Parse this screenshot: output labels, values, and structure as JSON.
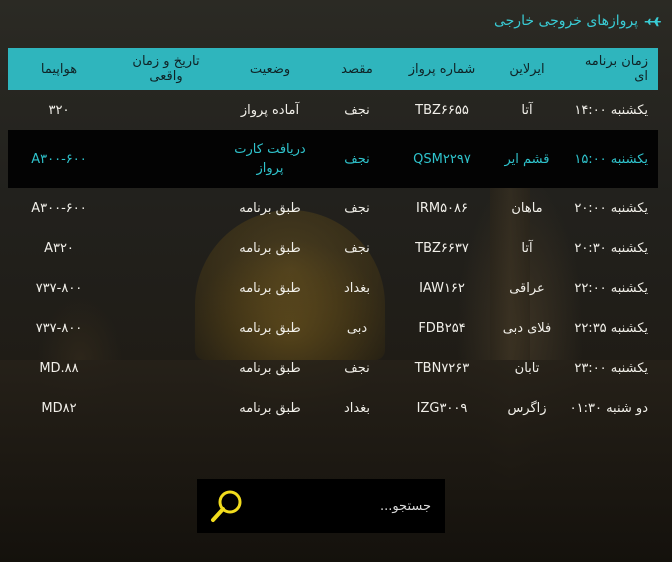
{
  "header": {
    "title": "پروازهای خروجی خارجی",
    "icon": "airplane-icon"
  },
  "table": {
    "columns": [
      "زمان برنامه ای",
      "ایرلاین",
      "شماره پرواز",
      "مقصد",
      "وضعیت",
      "تاریخ و زمان واقعی",
      "هواپیما"
    ],
    "rows": [
      {
        "time": "یکشنبه ۱۴:۰۰",
        "airline": "آتا",
        "flight": "TBZ۶۶۵۵",
        "dest": "نجف",
        "status": "آماده پرواز",
        "actual": "",
        "aircraft": "۳۲۰"
      },
      {
        "time": "یکشنبه ۱۵:۰۰",
        "airline": "قشم ایر",
        "flight": "QSM۲۲۹۷",
        "dest": "نجف",
        "status": "دریافت کارت پرواز",
        "actual": "",
        "aircraft": "A۳۰۰-۶۰۰"
      },
      {
        "time": "یکشنبه ۲۰:۰۰",
        "airline": "ماهان",
        "flight": "IRM۵۰۸۶",
        "dest": "نجف",
        "status": "طبق برنامه",
        "actual": "",
        "aircraft": "A۳۰۰-۶۰۰"
      },
      {
        "time": "یکشنبه ۲۰:۳۰",
        "airline": "آتا",
        "flight": "TBZ۶۶۳۷",
        "dest": "نجف",
        "status": "طبق برنامه",
        "actual": "",
        "aircraft": "A۳۲۰"
      },
      {
        "time": "یکشنبه ۲۲:۰۰",
        "airline": "عراقی",
        "flight": "IAW۱۶۲",
        "dest": "بغداد",
        "status": "طبق برنامه",
        "actual": "",
        "aircraft": "۷۳۷-۸۰۰"
      },
      {
        "time": "یکشنبه ۲۲:۳۵",
        "airline": "فلای دبی",
        "flight": "FDB۲۵۴",
        "dest": "دبی",
        "status": "طبق برنامه",
        "actual": "",
        "aircraft": "۷۳۷-۸۰۰"
      },
      {
        "time": "یکشنبه ۲۳:۰۰",
        "airline": "تابان",
        "flight": "TBN۷۲۶۳",
        "dest": "نجف",
        "status": "طبق برنامه",
        "actual": "",
        "aircraft": "MD.۸۸"
      },
      {
        "time": "دو شنبه ۰۱:۳۰",
        "airline": "زاگرس",
        "flight": "IZG۳۰۰۹",
        "dest": "بغداد",
        "status": "طبق برنامه",
        "actual": "",
        "aircraft": "MD۸۲"
      }
    ]
  },
  "search": {
    "placeholder": "جستجو...",
    "button_icon": "search-icon"
  },
  "colors": {
    "accent": "#2fb5bd",
    "highlight_text": "#2fc3cc",
    "highlight_row": "#030303",
    "search_icon": "#f2dc1d"
  }
}
